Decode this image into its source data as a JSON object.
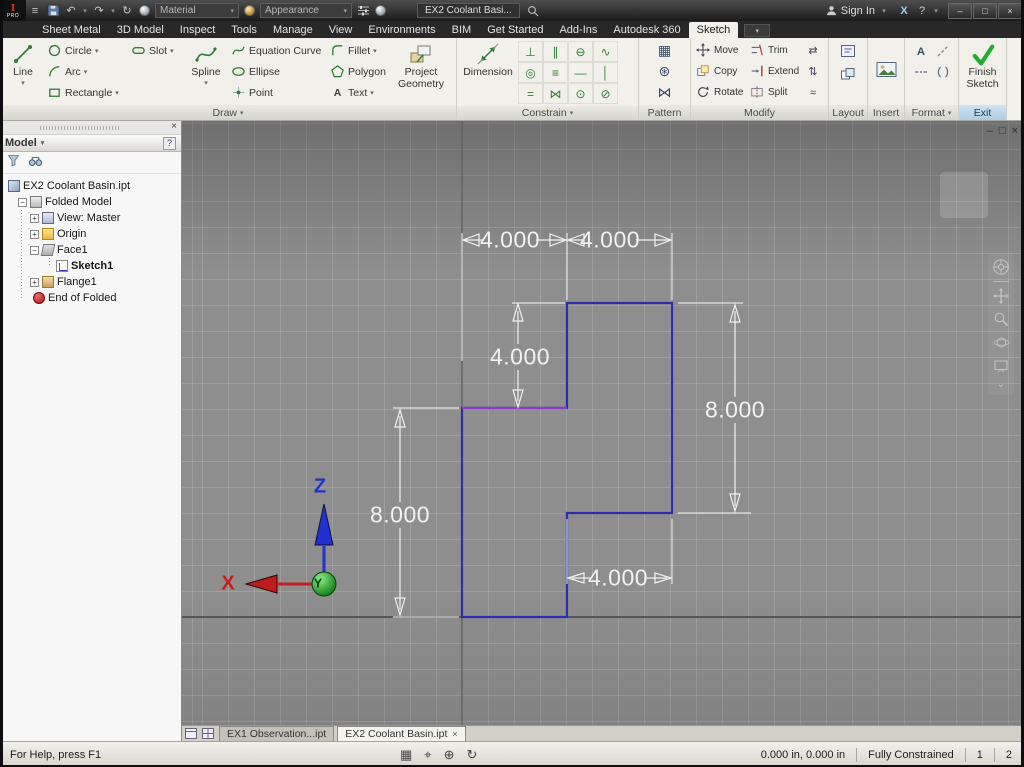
{
  "icons": {
    "dropdown": "▾",
    "close": "×",
    "minimize": "–",
    "maximize": "□",
    "help": "?",
    "plus": "+",
    "minus": "−",
    "undo": "↶",
    "redo": "↷",
    "menu": "≡",
    "update": "↻",
    "exchange": "X",
    "constraints": [
      "⊥",
      "∥",
      "⊖",
      "∿",
      "◎",
      "≡",
      "—",
      "│",
      "=",
      "⋈",
      "⊙",
      "⊘"
    ],
    "patterns": [
      "▦",
      "⊛",
      "⋈"
    ],
    "modify_extra": [
      "⇄",
      "⇅",
      "≈"
    ],
    "status": [
      "▦",
      "⌖",
      "⊕",
      "↻"
    ],
    "nav_more": "⌄"
  },
  "colors": {
    "finish_check": "#1fae32",
    "sketch_line": "#2e2ca8",
    "sketch_line_alt": "#8a3cc8",
    "dimension_text": "#f2f2f2",
    "axis_x": "#c22222",
    "axis_y": "#0f7a12",
    "axis_z": "#2233cc"
  },
  "titlebar": {
    "logo_i": "I",
    "logo_pro": "PRO",
    "material": "Material",
    "appearance": "Appearance",
    "doc_title": "EX2 Coolant Basi...",
    "sign_in": "Sign In"
  },
  "ribbon_tabs": [
    {
      "label": "Sheet Metal"
    },
    {
      "label": "3D Model"
    },
    {
      "label": "Inspect"
    },
    {
      "label": "Tools"
    },
    {
      "label": "Manage"
    },
    {
      "label": "View"
    },
    {
      "label": "Environments"
    },
    {
      "label": "BIM"
    },
    {
      "label": "Get Started"
    },
    {
      "label": "Add-Ins"
    },
    {
      "label": "Autodesk 360"
    },
    {
      "label": "Sketch"
    }
  ],
  "draw": {
    "label": "Draw",
    "line": "Line",
    "circle": "Circle",
    "arc": "Arc",
    "rectangle": "Rectangle",
    "slot": "Slot",
    "spline": "Spline",
    "equation_curve": "Equation Curve",
    "ellipse": "Ellipse",
    "point": "Point",
    "fillet": "Fillet",
    "polygon": "Polygon",
    "text": "Text",
    "project_geometry": "Project Geometry"
  },
  "constrain": {
    "label": "Constrain",
    "dimension": "Dimension"
  },
  "pattern": {
    "label": "Pattern"
  },
  "modify": {
    "label": "Modify",
    "move": "Move",
    "copy": "Copy",
    "rotate": "Rotate",
    "trim": "Trim",
    "extend": "Extend",
    "split": "Split"
  },
  "layout": {
    "label": "Layout"
  },
  "insert": {
    "label": "Insert"
  },
  "format": {
    "label": "Format"
  },
  "exit": {
    "label": "Exit",
    "finish": "Finish Sketch"
  },
  "browser": {
    "title": "Model",
    "items": [
      {
        "label": "EX2 Coolant Basin.ipt"
      },
      {
        "label": "Folded Model"
      },
      {
        "label": "View: Master"
      },
      {
        "label": "Origin"
      },
      {
        "label": "Face1"
      },
      {
        "label": "Sketch1"
      },
      {
        "label": "Flange1"
      },
      {
        "label": "End of Folded"
      }
    ]
  },
  "canvas": {
    "dim_top_left": "4.000",
    "dim_top_right": "4.000",
    "dim_mid": "4.000",
    "dim_right": "8.000",
    "dim_left": "8.000",
    "dim_bottom": "4.000",
    "axis_x": "X",
    "axis_y": "Y",
    "axis_z": "Z"
  },
  "doc_tabs": [
    {
      "label": "EX1 Observation...ipt"
    },
    {
      "label": "EX2 Coolant Basin.ipt"
    }
  ],
  "statusbar": {
    "help": "For Help, press F1",
    "coords": "0.000 in, 0.000 in",
    "constraint": "Fully Constrained",
    "n1": "1",
    "n2": "2"
  }
}
